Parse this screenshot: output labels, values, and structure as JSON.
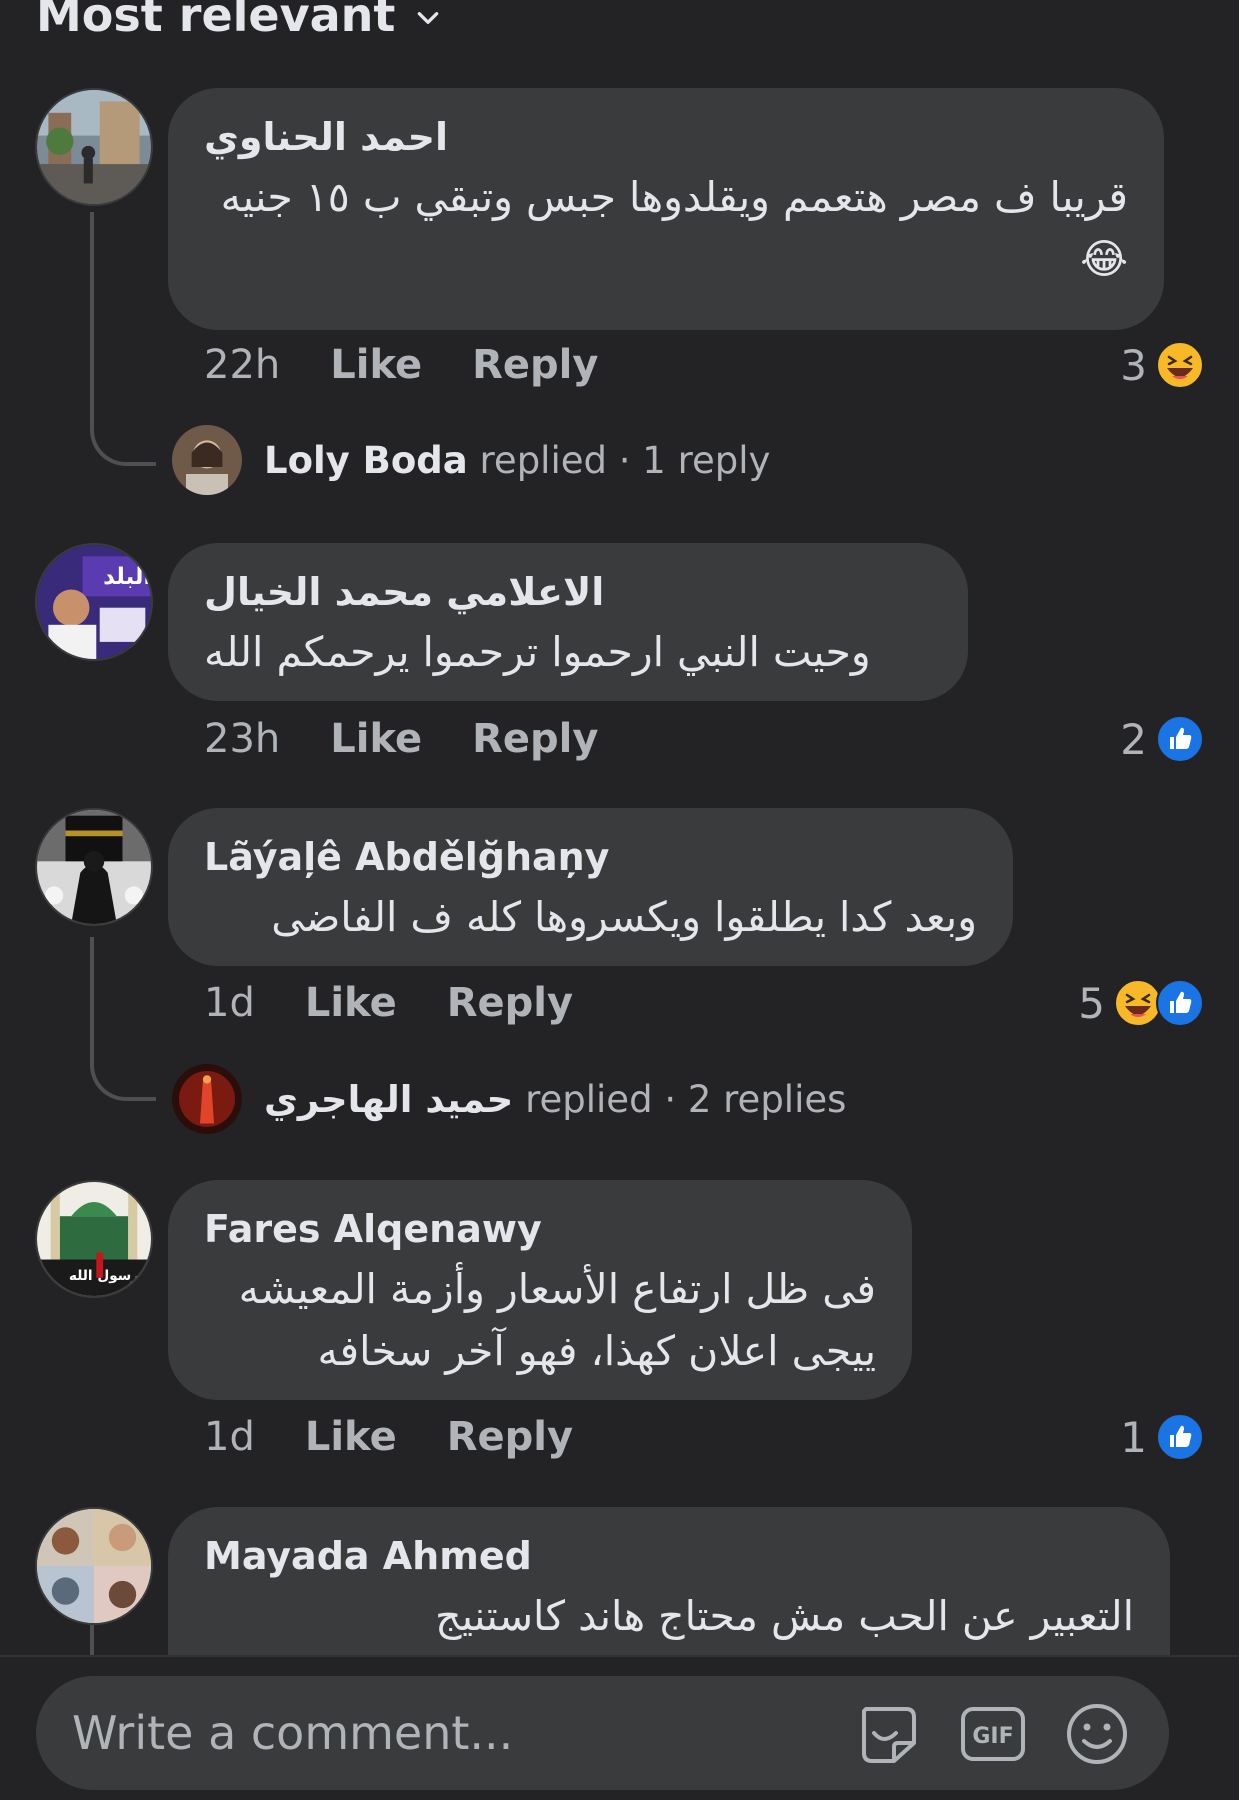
{
  "sort": {
    "label": "Most relevant",
    "icon": "chevron-down-icon"
  },
  "comments": [
    {
      "author": "احمد الحناوي",
      "text": "قريبا ف مصر هتعمم ويقلدوها جبس وتبقي ب ١٥ جنيه 😂",
      "time": "22h",
      "like_label": "Like",
      "reply_label": "Reply",
      "reaction_count": "3",
      "reactions": [
        "haha-icon"
      ],
      "replies_preview": {
        "name": "Loly Boda",
        "verb": "replied",
        "count": "· 1 reply"
      }
    },
    {
      "author": "الاعلامي محمد الخيال",
      "text": "وحيت النبي ارحموا ترحموا يرحمكم الله",
      "time": "23h",
      "like_label": "Like",
      "reply_label": "Reply",
      "reaction_count": "2",
      "reactions": [
        "like-icon"
      ]
    },
    {
      "author": "Lãýaļê Abdělğhaņy",
      "text": "وبعد كدا يطلقوا ويكسروها كله ف الفاضى",
      "time": "1d",
      "like_label": "Like",
      "reply_label": "Reply",
      "reaction_count": "5",
      "reactions": [
        "haha-icon",
        "like-icon"
      ],
      "replies_preview": {
        "name": "حميد الهاجري",
        "verb": "replied",
        "count": "· 2 replies"
      }
    },
    {
      "author": "Fares Alqenawy",
      "text": "فى ظل ارتفاع الأسعار وأزمة المعيشه ييجى اعلان كهذا، فهو آخر سخافه",
      "time": "1d",
      "like_label": "Like",
      "reply_label": "Reply",
      "reaction_count": "1",
      "reactions": [
        "like-icon"
      ]
    },
    {
      "author": "Mayada Ahmed",
      "text": "التعبير عن الحب مش محتاج هاند كاستنيج"
    }
  ],
  "composer": {
    "placeholder": "Write a comment...",
    "icons": [
      "sticker-icon",
      "gif-icon",
      "emoji-icon"
    ],
    "gif_label": "GIF"
  },
  "colors": {
    "background": "#232325",
    "bubble": "#3a3b3c",
    "primary_text": "#e4e6eb",
    "secondary_text": "#b0b3b8",
    "like_blue": "#1b74e4",
    "haha_yellow": "#f7b928"
  }
}
